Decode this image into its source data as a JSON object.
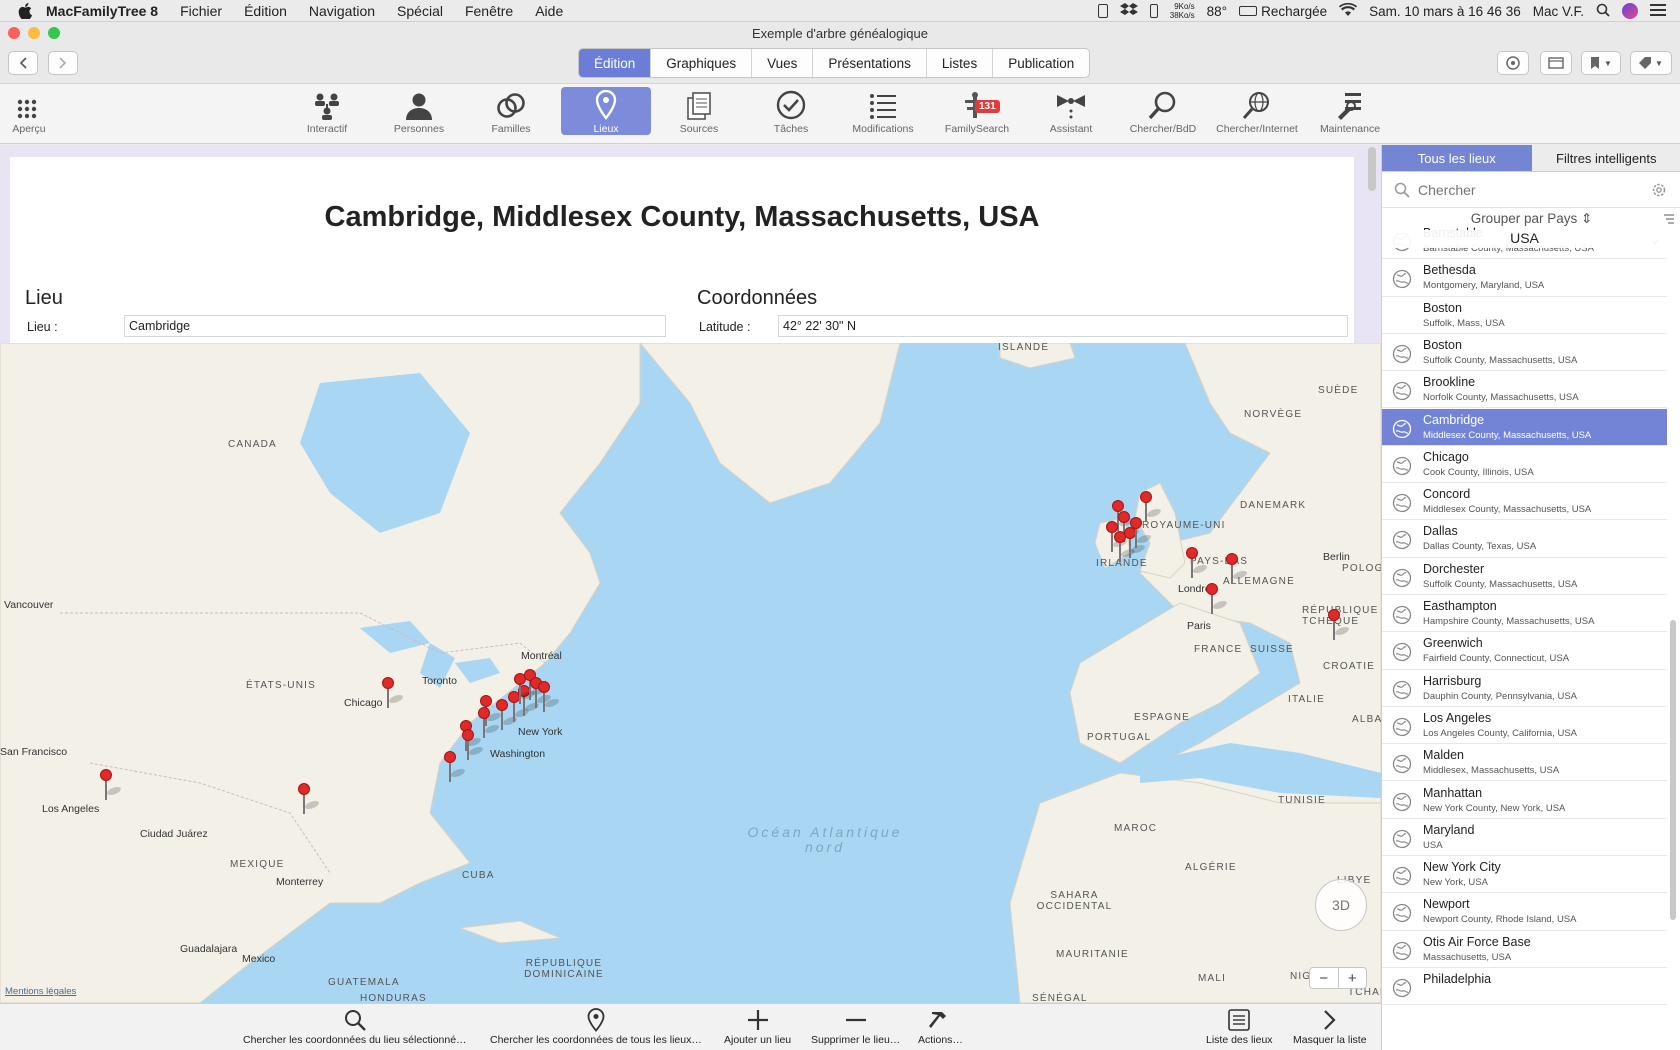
{
  "menubar": {
    "app_name": "MacFamilyTree 8",
    "items": [
      "Fichier",
      "Édition",
      "Navigation",
      "Spécial",
      "Fenêtre",
      "Aide"
    ],
    "net_speed_up": "9Ko/s",
    "net_speed_down": "38Ko/s",
    "temperature": "88°",
    "battery_status": "Rechargée",
    "datetime": "Sam. 10 mars à  16 46 36",
    "user": "Mac V.F."
  },
  "window": {
    "title": "Exemple d'arbre généalogique"
  },
  "top_tabs": [
    "Édition",
    "Graphiques",
    "Vues",
    "Présentations",
    "Listes",
    "Publication"
  ],
  "selected_top_tab": "Édition",
  "toolbar": {
    "items": [
      {
        "label": "Aperçu",
        "icon": "grid-icon"
      },
      {
        "label": "Interactif",
        "icon": "interactive-tree-icon"
      },
      {
        "label": "Personnes",
        "icon": "person-icon"
      },
      {
        "label": "Familles",
        "icon": "rings-icon"
      },
      {
        "label": "Lieux",
        "icon": "location-pin-icon"
      },
      {
        "label": "Sources",
        "icon": "documents-icon"
      },
      {
        "label": "Tâches",
        "icon": "checkmark-icon"
      },
      {
        "label": "Modifications",
        "icon": "list-icon"
      },
      {
        "label": "FamilySearch",
        "icon": "familysearch-icon",
        "badge": "131"
      },
      {
        "label": "Assistant",
        "icon": "assistant-icon"
      },
      {
        "label": "Chercher/BdD",
        "icon": "magnifier-icon"
      },
      {
        "label": "Chercher/Internet",
        "icon": "globe-search-icon"
      },
      {
        "label": "Maintenance",
        "icon": "maintenance-icon"
      }
    ],
    "selected": "Lieux"
  },
  "detail": {
    "title": "Cambridge, Middlesex County, Massachusetts, USA",
    "section_place": "Lieu",
    "section_coords": "Coordonnées",
    "place_label": "Lieu :",
    "place_value": "Cambridge",
    "latitude_label": "Latitude :",
    "latitude_value": "42° 22' 30\" N"
  },
  "map": {
    "countries": [
      "CANADA",
      "ÉTATS-UNIS",
      "MEXIQUE",
      "CUBA",
      "ISLANDE",
      "NORVÈGE",
      "SUÈDE",
      "DANEMARK",
      "ROYAUME-UNI",
      "IRLANDE",
      "PAYS-BAS",
      "ALLEMAGNE",
      "POLOGNE",
      "RÉPUBLIQUE TCHÈQUE",
      "FRANCE",
      "SUISSE",
      "CROATIE",
      "ITALIE",
      "ESPAGNE",
      "PORTUGAL",
      "ALBANIE",
      "TUNISIE",
      "MAROC",
      "ALGÉRIE",
      "LIBYE",
      "SAHARA OCCIDENTAL",
      "MAURITANIE",
      "MALI",
      "NIGER",
      "TCHAD",
      "GUATEMALA",
      "HONDURAS",
      "RÉPUBLIQUE DOMINICAINE",
      "SÉNÉGAL"
    ],
    "cities": [
      "Vancouver",
      "San Francisco",
      "Los Angeles",
      "Ciudad Juárez",
      "Monterrey",
      "Guadalajara",
      "Mexico",
      "Chicago",
      "Toronto",
      "Montréal",
      "New York",
      "Washington",
      "Londres",
      "Paris",
      "Berlin"
    ],
    "ocean": "Océan Atlantique nord",
    "legal": "Mentions légales",
    "compass": "3D",
    "zoom_out": "−",
    "zoom_in": "+"
  },
  "bottom_actions": [
    {
      "label": "Chercher les coordonnées du lieu sélectionné…",
      "icon": "magnifier-icon"
    },
    {
      "label": "Chercher les coordonnées de tous les lieux…",
      "icon": "location-pin-icon"
    },
    {
      "label": "Ajouter un lieu",
      "icon": "plus-icon"
    },
    {
      "label": "Supprimer le lieu…",
      "icon": "minus-icon"
    },
    {
      "label": "Actions…",
      "icon": "hammer-icon"
    },
    {
      "label": "Liste des lieux",
      "icon": "list-icon"
    },
    {
      "label": "Masquer la liste",
      "icon": "chevron-right-icon"
    }
  ],
  "sidebar": {
    "tabs": [
      "Tous les lieux",
      "Filtres intelligents"
    ],
    "selected_tab": "Tous les lieux",
    "search_placeholder": "Chercher",
    "group_by": "Grouper par Pays ⇕",
    "group_header": "USA",
    "places": [
      {
        "name": "Barnstable",
        "sub": "Barnstable County, Massachusetts, USA",
        "globe": true
      },
      {
        "name": "Bethesda",
        "sub": "Montgomery, Maryland, USA",
        "globe": true
      },
      {
        "name": "Boston",
        "sub": "Suffolk, Mass, USA",
        "globe": false
      },
      {
        "name": "Boston",
        "sub": "Suffolk County, Massachusetts, USA",
        "globe": true
      },
      {
        "name": "Brookline",
        "sub": "Norfolk County, Massachusetts, USA",
        "globe": true
      },
      {
        "name": "Cambridge",
        "sub": "Middlesex County, Massachusetts, USA",
        "globe": true
      },
      {
        "name": "Chicago",
        "sub": "Cook County, Illinois, USA",
        "globe": true
      },
      {
        "name": "Concord",
        "sub": "Middlesex County, Massachusetts, USA",
        "globe": true
      },
      {
        "name": "Dallas",
        "sub": "Dallas County, Texas, USA",
        "globe": true
      },
      {
        "name": "Dorchester",
        "sub": "Suffolk County, Massachusetts, USA",
        "globe": true
      },
      {
        "name": "Easthampton",
        "sub": "Hampshire County, Massachusetts, USA",
        "globe": true
      },
      {
        "name": "Greenwich",
        "sub": "Fairfield County, Connecticut, USA",
        "globe": true
      },
      {
        "name": "Harrisburg",
        "sub": "Dauphin County, Pennsylvania, USA",
        "globe": true
      },
      {
        "name": "Los Angeles",
        "sub": "Los Angeles County, California, USA",
        "globe": true
      },
      {
        "name": "Malden",
        "sub": "Middlesex, Massachusetts, USA",
        "globe": true
      },
      {
        "name": "Manhattan",
        "sub": "New York County, New York, USA",
        "globe": true
      },
      {
        "name": "Maryland",
        "sub": "USA",
        "globe": true
      },
      {
        "name": "New York City",
        "sub": "New York, USA",
        "globe": true
      },
      {
        "name": "Newport",
        "sub": "Newport County, Rhode Island, USA",
        "globe": true
      },
      {
        "name": "Otis Air Force Base",
        "sub": "Massachusetts, USA",
        "globe": true
      },
      {
        "name": "Philadelphia",
        "sub": "",
        "globe": true
      }
    ],
    "selected_place": "Cambridge"
  },
  "colors": {
    "accent": "#6b7dd6",
    "selection": "#7384d6",
    "pin": "#e02a2a",
    "ocean": "#a9d6f2",
    "land": "#f3f0e7"
  }
}
